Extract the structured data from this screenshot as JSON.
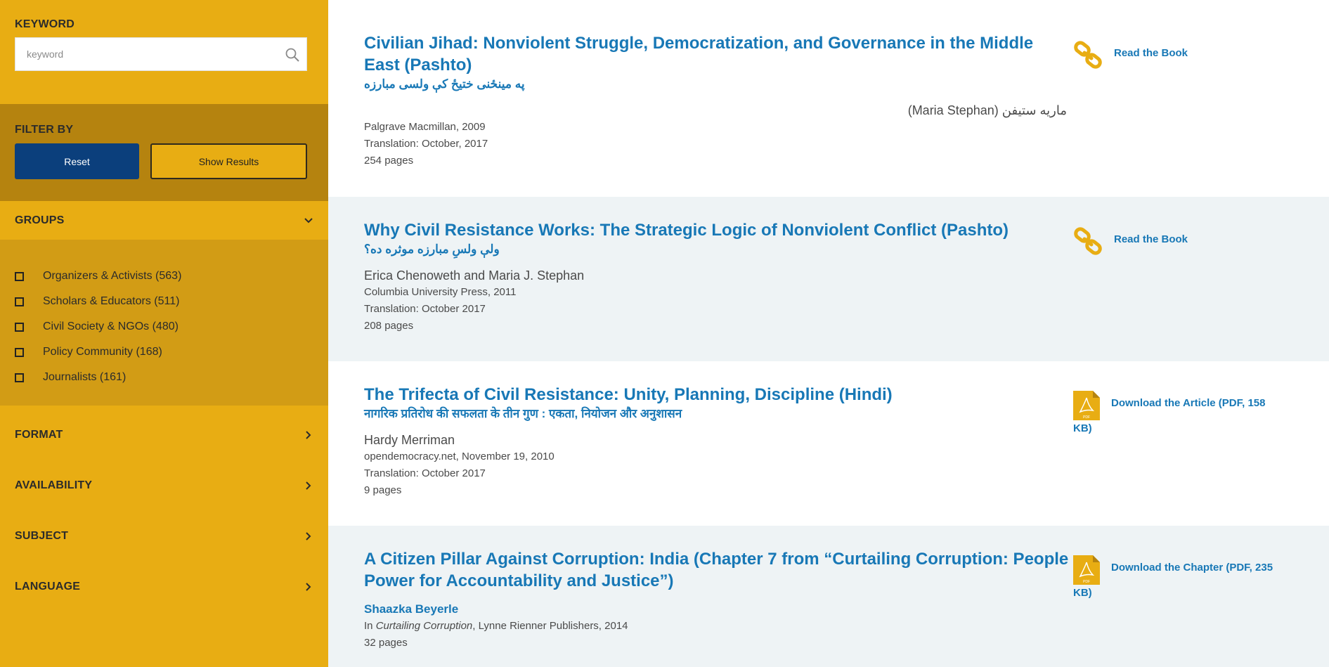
{
  "sidebar": {
    "keyword_label": "KEYWORD",
    "keyword_placeholder": "keyword",
    "filter_label": "FILTER BY",
    "reset_label": "Reset",
    "show_results_label": "Show Results",
    "groups_label": "GROUPS",
    "groups": [
      {
        "label": "Organizers & Activists (563)"
      },
      {
        "label": "Scholars & Educators (511)"
      },
      {
        "label": "Civil Society & NGOs (480)"
      },
      {
        "label": "Policy Community (168)"
      },
      {
        "label": "Journalists (161)"
      }
    ],
    "sections": [
      {
        "label": "FORMAT"
      },
      {
        "label": "AVAILABILITY"
      },
      {
        "label": "SUBJECT"
      },
      {
        "label": "LANGUAGE"
      }
    ]
  },
  "results": [
    {
      "title": "Civilian Jihad: Nonviolent Struggle, Democratization, and Governance in the Middle East (Pashto)",
      "subtitle": "په مینځنی ختیځ کې ولسی مبارزه",
      "author": "ماریه ستیفن (Maria Stephan)",
      "meta": [
        "Palgrave Macmillan, 2009",
        "Translation: October, 2017",
        "254 pages"
      ],
      "action": "Read the Book",
      "action_icon": "link-icon"
    },
    {
      "title": "Why Civil Resistance Works: The Strategic Logic of Nonviolent Conflict (Pashto)",
      "subtitle": "ولې ولسِ مبارزه موثره ده؟",
      "author": "Erica Chenoweth and Maria J. Stephan",
      "meta": [
        "Columbia University Press, 2011",
        "Translation: October 2017",
        "208 pages"
      ],
      "action": "Read the Book",
      "action_icon": "link-icon"
    },
    {
      "title": "The Trifecta of Civil Resistance: Unity, Planning, Discipline (Hindi)",
      "subtitle": "नागरिक प्रतिरोध की सफलता के तीन गुण : एकता, नियोजन और अनुशासन",
      "author": "Hardy Merriman",
      "meta": [
        "opendemocracy.net, November 19, 2010",
        "Translation: October 2017",
        "9 pages"
      ],
      "action": "Download the Article (PDF, 158 KB)",
      "action_line1": "Download the Article (PDF, 158",
      "action_line2": "KB)",
      "action_icon": "pdf-icon"
    },
    {
      "title": "A Citizen Pillar Against Corruption: India (Chapter 7 from “Curtailing Corruption: People Power for Accountability and Justice”)",
      "author": "Shaazka Beyerle",
      "meta_prefix": "In ",
      "meta_italic": "Curtailing Corruption",
      "meta_suffix": ", Lynne Rienner Publishers, 2014",
      "meta": [
        "32 pages"
      ],
      "action_line1": "Download the Chapter (PDF, 235",
      "action_line2": "KB)",
      "action_icon": "pdf-icon"
    }
  ],
  "colors": {
    "sidebar_bg": "#e8ad13",
    "filter_bg": "#b5830f",
    "groups_bg": "#d29c15",
    "link_blue": "#1878b6",
    "reset_blue": "#0b3f7c",
    "alt_row": "#eef3f5"
  }
}
